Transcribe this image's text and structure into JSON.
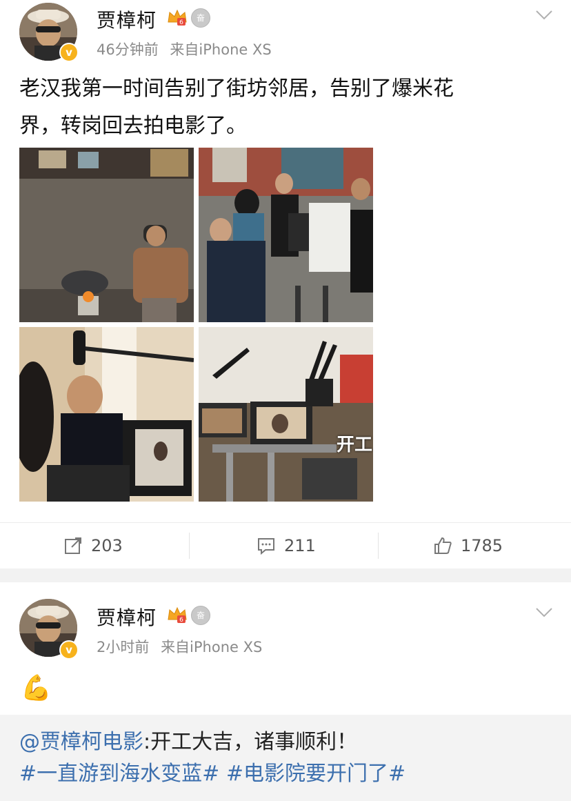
{
  "posts": [
    {
      "username": "贾樟柯",
      "time": "46分钟前",
      "source": "来自iPhone XS",
      "text_line1": "老汉我第一时间告别了街坊邻居，告别了爆米花",
      "text_line2": "界，转岗回去拍电影了。",
      "images": [
        "photo-popcorn-machine",
        "photo-film-crew",
        "photo-director-monitor",
        "photo-camera-monitors"
      ],
      "watermark_text": "开工",
      "actions": {
        "repost_count": "203",
        "comment_count": "211",
        "like_count": "1785"
      }
    },
    {
      "username": "贾樟柯",
      "time": "2小时前",
      "source": "来自iPhone XS",
      "emoji": "💪",
      "repost": {
        "mention": "@贾樟柯电影",
        "text": ":开工大吉，诸事顺利！",
        "hashtag1": "#一直游到海水变蓝#",
        "hashtag2": "#电影院要开门了#"
      }
    }
  ],
  "colors": {
    "link": "#3c6fae",
    "meta": "#8a8a8a",
    "badge": "#f7b21c",
    "separator": "#f2f2f2"
  },
  "icons": [
    "verified-badge-icon",
    "crown-vip-icon",
    "medal-icon",
    "chevron-down-icon",
    "repost-icon",
    "comment-icon",
    "like-icon"
  ]
}
